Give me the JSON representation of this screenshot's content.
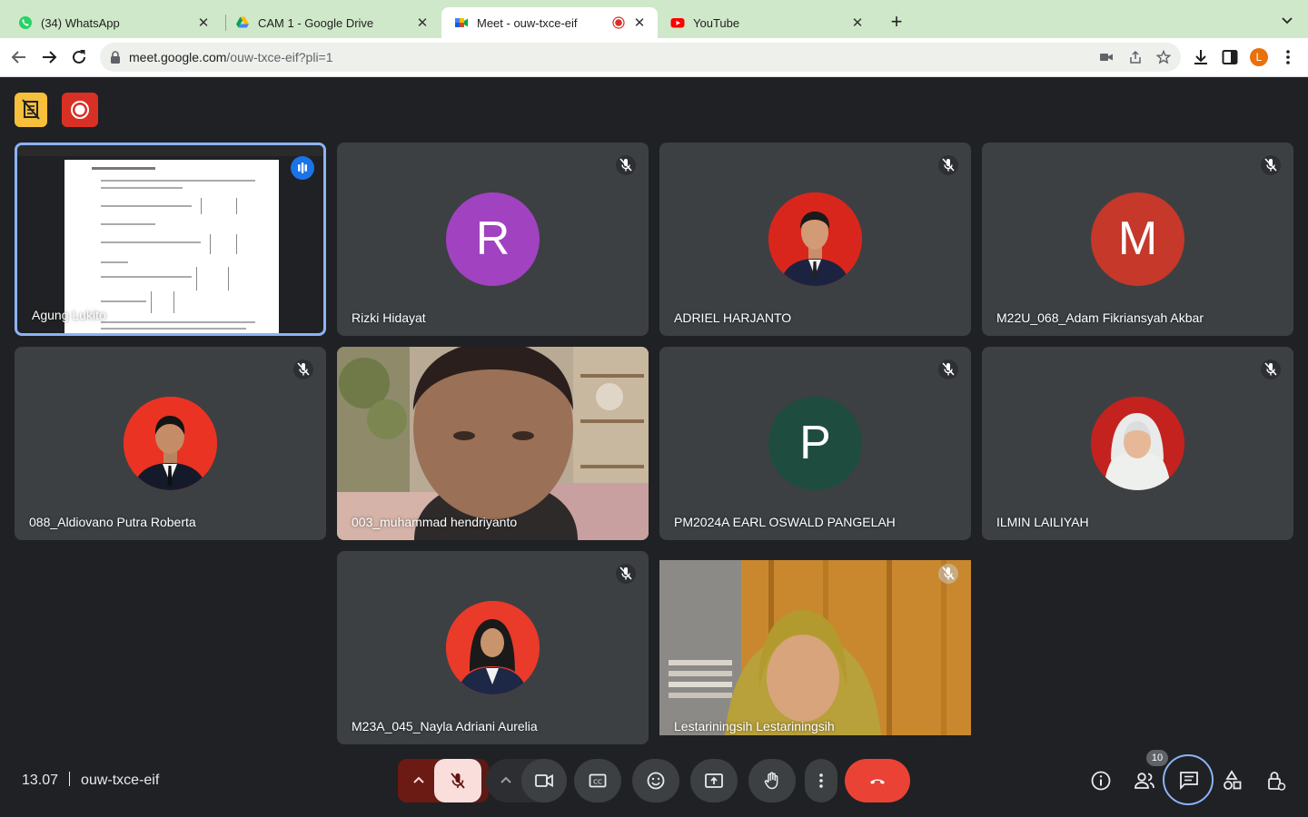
{
  "browser": {
    "tabs": [
      {
        "title": "(34) WhatsApp",
        "icon": "whatsapp-icon",
        "active": false
      },
      {
        "title": "CAM 1 - Google Drive",
        "icon": "google-drive-icon",
        "active": false
      },
      {
        "title": "Meet - ouw-txce-eif",
        "icon": "google-meet-icon",
        "active": true,
        "recording": true
      },
      {
        "title": "YouTube",
        "icon": "youtube-icon",
        "active": false
      }
    ],
    "url_domain": "meet.google.com",
    "url_path": "/ouw-txce-eif?pli=1",
    "profile_initial": "L"
  },
  "meet": {
    "participants": [
      {
        "name": "Agung Lukito",
        "type": "screen-share",
        "speaking": true
      },
      {
        "name": "Rizki Hidayat",
        "type": "initial",
        "initial": "R",
        "color": "#a142c1",
        "muted": true
      },
      {
        "name": "ADRIEL HARJANTO",
        "type": "photo",
        "muted": true
      },
      {
        "name": "M22U_068_Adam Fikriansyah Akbar",
        "type": "initial",
        "initial": "M",
        "color": "#c5382a",
        "muted": true
      },
      {
        "name": "088_Aldiovano Putra Roberta",
        "type": "photo",
        "muted": true
      },
      {
        "name": "003_muhammad hendriyanto",
        "type": "camera",
        "muted": false
      },
      {
        "name": "PM2024A EARL OSWALD PANGELAH",
        "type": "initial",
        "initial": "P",
        "color": "#1e4d3f",
        "muted": true
      },
      {
        "name": "ILMIN LAILIYAH",
        "type": "photo",
        "muted": true
      },
      {
        "name": "M23A_045_Nayla Adriani Aurelia",
        "type": "photo",
        "muted": true
      },
      {
        "name": "Lestariningsih Lestariningsih",
        "type": "camera",
        "muted": true
      }
    ],
    "time": "13.07",
    "meeting_code": "ouw-txce-eif",
    "people_count": "10",
    "controls": [
      "mic-options",
      "mic-muted",
      "camera-options",
      "camera",
      "captions",
      "reactions",
      "present",
      "raise-hand",
      "more-options",
      "leave-call"
    ],
    "right_controls": [
      "info",
      "people",
      "chat",
      "activities",
      "host-controls"
    ],
    "colors": {
      "background": "#202124",
      "tile": "#3c4043",
      "leave": "#ea4335",
      "mute_active": "#f9dedc",
      "active_speaker_border": "#8ab4f8"
    }
  }
}
